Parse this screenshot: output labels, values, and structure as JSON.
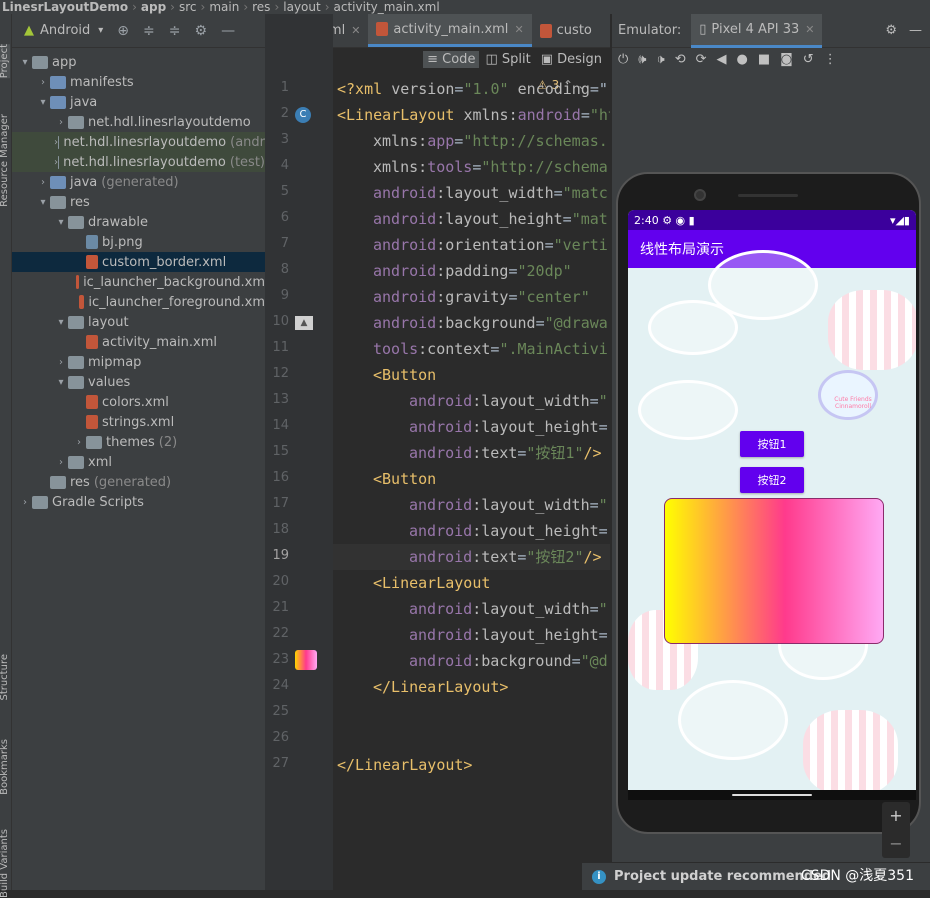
{
  "breadcrumb": [
    "LinesrLayoutDemo",
    "app",
    "src",
    "main",
    "res",
    "layout",
    "activity_main.xml"
  ],
  "left_strip": {
    "project": "Project",
    "resource_manager": "Resource Manager",
    "structure": "Structure",
    "bookmarks": "Bookmarks",
    "build_variants": "Build Variants"
  },
  "project_panel": {
    "view_selector": "Android",
    "tree": [
      {
        "label": "app",
        "level": 0,
        "arrow": "▾",
        "icon": "folder"
      },
      {
        "label": "manifests",
        "level": 1,
        "arrow": "›",
        "icon": "folder-blue"
      },
      {
        "label": "java",
        "level": 1,
        "arrow": "▾",
        "icon": "folder-blue"
      },
      {
        "label": "net.hdl.linesrlayoutdemo",
        "level": 2,
        "arrow": "›",
        "icon": "folder"
      },
      {
        "label": "net.hdl.linesrlayoutdemo",
        "suffix": "(andr",
        "level": 2,
        "arrow": "›",
        "icon": "folder",
        "hl": true
      },
      {
        "label": "net.hdl.linesrlayoutdemo",
        "suffix": "(test)",
        "level": 2,
        "arrow": "›",
        "icon": "folder",
        "hl": true
      },
      {
        "label": "java",
        "suffix": "(generated)",
        "level": 1,
        "arrow": "›",
        "icon": "folder-blue"
      },
      {
        "label": "res",
        "level": 1,
        "arrow": "▾",
        "icon": "folder"
      },
      {
        "label": "drawable",
        "level": 2,
        "arrow": "▾",
        "icon": "folder"
      },
      {
        "label": "bj.png",
        "level": 3,
        "arrow": "",
        "icon": "file-img"
      },
      {
        "label": "custom_border.xml",
        "level": 3,
        "arrow": "",
        "icon": "file-xml",
        "sel": true
      },
      {
        "label": "ic_launcher_background.xm",
        "level": 3,
        "arrow": "",
        "icon": "file-xml"
      },
      {
        "label": "ic_launcher_foreground.xm",
        "level": 3,
        "arrow": "",
        "icon": "file-xml"
      },
      {
        "label": "layout",
        "level": 2,
        "arrow": "▾",
        "icon": "folder"
      },
      {
        "label": "activity_main.xml",
        "level": 3,
        "arrow": "",
        "icon": "file-xml"
      },
      {
        "label": "mipmap",
        "level": 2,
        "arrow": "›",
        "icon": "folder"
      },
      {
        "label": "values",
        "level": 2,
        "arrow": "▾",
        "icon": "folder"
      },
      {
        "label": "colors.xml",
        "level": 3,
        "arrow": "",
        "icon": "file-xml"
      },
      {
        "label": "strings.xml",
        "level": 3,
        "arrow": "",
        "icon": "file-xml"
      },
      {
        "label": "themes",
        "suffix": "(2)",
        "level": 3,
        "arrow": "›",
        "icon": "folder"
      },
      {
        "label": "xml",
        "level": 2,
        "arrow": "›",
        "icon": "folder"
      },
      {
        "label": "res",
        "suffix": "(generated)",
        "level": 1,
        "arrow": "",
        "icon": "folder"
      },
      {
        "label": "Gradle Scripts",
        "level": 0,
        "arrow": "›",
        "icon": "folder"
      }
    ]
  },
  "editor": {
    "tabs": [
      {
        "label": "strings.xml",
        "active": false
      },
      {
        "label": "activity_main.xml",
        "active": true
      },
      {
        "label": "custo",
        "active": false
      }
    ],
    "view_modes": [
      "Code",
      "Split",
      "Design"
    ],
    "warnings": "3",
    "current_line": 19,
    "lines": [
      {
        "n": 1,
        "ind": 0,
        "parts": [
          [
            "tag",
            "<?xml "
          ],
          [
            "attr",
            "version"
          ],
          [
            "plain",
            "="
          ],
          [
            "str",
            "\"1.0\""
          ],
          [
            "attr",
            " encoding"
          ],
          [
            "plain",
            "=\""
          ]
        ]
      },
      {
        "n": 2,
        "ind": 0,
        "parts": [
          [
            "tag",
            "<LinearLayout "
          ],
          [
            "attr",
            "xmlns:"
          ],
          [
            "ns",
            "android"
          ],
          [
            "plain",
            "="
          ],
          [
            "str",
            "\"ht"
          ]
        ]
      },
      {
        "n": 3,
        "ind": 1,
        "parts": [
          [
            "attr",
            "xmlns:"
          ],
          [
            "ns",
            "app"
          ],
          [
            "plain",
            "="
          ],
          [
            "str",
            "\"http://schemas."
          ]
        ]
      },
      {
        "n": 4,
        "ind": 1,
        "parts": [
          [
            "attr",
            "xmlns:"
          ],
          [
            "ns",
            "tools"
          ],
          [
            "plain",
            "="
          ],
          [
            "str",
            "\"http://schema"
          ]
        ]
      },
      {
        "n": 5,
        "ind": 1,
        "parts": [
          [
            "ns",
            "android"
          ],
          [
            "attr",
            ":layout_width"
          ],
          [
            "plain",
            "="
          ],
          [
            "str",
            "\"matc"
          ]
        ]
      },
      {
        "n": 6,
        "ind": 1,
        "parts": [
          [
            "ns",
            "android"
          ],
          [
            "attr",
            ":layout_height"
          ],
          [
            "plain",
            "="
          ],
          [
            "str",
            "\"mat"
          ]
        ]
      },
      {
        "n": 7,
        "ind": 1,
        "parts": [
          [
            "ns",
            "android"
          ],
          [
            "attr",
            ":orientation"
          ],
          [
            "plain",
            "="
          ],
          [
            "str",
            "\"verti"
          ]
        ]
      },
      {
        "n": 8,
        "ind": 1,
        "parts": [
          [
            "ns",
            "android"
          ],
          [
            "attr",
            ":padding"
          ],
          [
            "plain",
            "="
          ],
          [
            "str",
            "\"20dp\""
          ]
        ]
      },
      {
        "n": 9,
        "ind": 1,
        "parts": [
          [
            "ns",
            "android"
          ],
          [
            "attr",
            ":gravity"
          ],
          [
            "plain",
            "="
          ],
          [
            "str",
            "\"center\""
          ]
        ]
      },
      {
        "n": 10,
        "ind": 1,
        "parts": [
          [
            "ns",
            "android"
          ],
          [
            "attr",
            ":background"
          ],
          [
            "plain",
            "="
          ],
          [
            "str",
            "\"@drawa"
          ]
        ]
      },
      {
        "n": 11,
        "ind": 1,
        "parts": [
          [
            "ns",
            "tools"
          ],
          [
            "attr",
            ":context"
          ],
          [
            "plain",
            "="
          ],
          [
            "str",
            "\".MainActivi"
          ]
        ]
      },
      {
        "n": 12,
        "ind": 1,
        "parts": [
          [
            "tag",
            "<Button"
          ]
        ]
      },
      {
        "n": 13,
        "ind": 2,
        "parts": [
          [
            "ns",
            "android"
          ],
          [
            "attr",
            ":layout_width"
          ],
          [
            "plain",
            "="
          ],
          [
            "str",
            "\""
          ]
        ]
      },
      {
        "n": 14,
        "ind": 2,
        "parts": [
          [
            "ns",
            "android"
          ],
          [
            "attr",
            ":layout_height"
          ],
          [
            "plain",
            "="
          ]
        ]
      },
      {
        "n": 15,
        "ind": 2,
        "parts": [
          [
            "ns",
            "android"
          ],
          [
            "attr",
            ":text"
          ],
          [
            "plain",
            "="
          ],
          [
            "str",
            "\"按钮1\""
          ],
          [
            "tag",
            "/>"
          ]
        ]
      },
      {
        "n": 16,
        "ind": 1,
        "parts": [
          [
            "tag",
            "<Button"
          ]
        ]
      },
      {
        "n": 17,
        "ind": 2,
        "parts": [
          [
            "ns",
            "android"
          ],
          [
            "attr",
            ":layout_width"
          ],
          [
            "plain",
            "="
          ],
          [
            "str",
            "\""
          ]
        ]
      },
      {
        "n": 18,
        "ind": 2,
        "parts": [
          [
            "ns",
            "android"
          ],
          [
            "attr",
            ":layout_height"
          ],
          [
            "plain",
            "="
          ]
        ]
      },
      {
        "n": 19,
        "ind": 2,
        "parts": [
          [
            "ns",
            "android"
          ],
          [
            "attr",
            ":text"
          ],
          [
            "plain",
            "="
          ],
          [
            "str",
            "\"按钮2\""
          ],
          [
            "tag",
            "/>"
          ]
        ]
      },
      {
        "n": 20,
        "ind": 1,
        "parts": [
          [
            "tag",
            "<LinearLayout"
          ]
        ]
      },
      {
        "n": 21,
        "ind": 2,
        "parts": [
          [
            "ns",
            "android"
          ],
          [
            "attr",
            ":layout_width"
          ],
          [
            "plain",
            "="
          ],
          [
            "str",
            "\""
          ]
        ]
      },
      {
        "n": 22,
        "ind": 2,
        "parts": [
          [
            "ns",
            "android"
          ],
          [
            "attr",
            ":layout_height"
          ],
          [
            "plain",
            "="
          ]
        ]
      },
      {
        "n": 23,
        "ind": 2,
        "parts": [
          [
            "ns",
            "android"
          ],
          [
            "attr",
            ":background"
          ],
          [
            "plain",
            "="
          ],
          [
            "str",
            "\"@d"
          ]
        ]
      },
      {
        "n": 24,
        "ind": 1,
        "parts": [
          [
            "tag",
            "</LinearLayout>"
          ]
        ]
      },
      {
        "n": 25,
        "ind": 0,
        "parts": []
      },
      {
        "n": 26,
        "ind": 0,
        "parts": []
      },
      {
        "n": 27,
        "ind": 0,
        "parts": [
          [
            "tag",
            "</LinearLayout>"
          ]
        ]
      }
    ]
  },
  "emulator": {
    "label": "Emulator:",
    "device_tab": "Pixel 4 API 33",
    "status_time": "2:40",
    "app_title": "线性布局演示",
    "button1": "按钮1",
    "button2": "按钮2",
    "cloud_text": "Cute Friends Cinnamoroll"
  },
  "notification": {
    "text": "Project update recommended",
    "watermark": "CSDN @浅夏351"
  },
  "colors": {
    "accent": "#6200ee",
    "statusbar": "#3b009c",
    "editor_bg": "#2b2b2b",
    "panel_bg": "#3c3f41"
  }
}
